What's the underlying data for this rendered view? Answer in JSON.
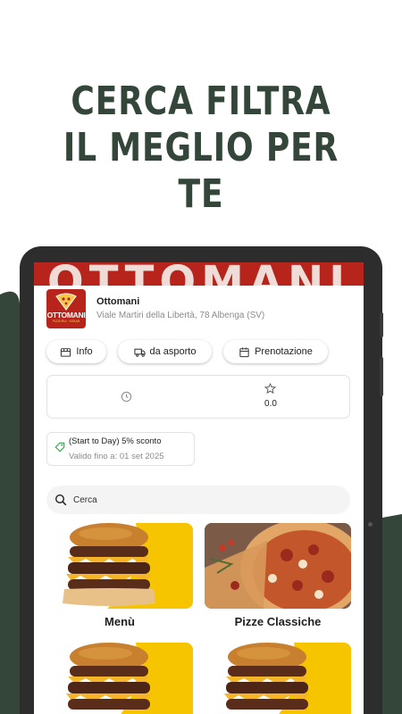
{
  "promo_headline": {
    "line1": "CERCA FILTRA",
    "line2": "IL MEGLIO PER TE"
  },
  "colors": {
    "brand_green": "#34463a",
    "brand_red": "#b6241c",
    "accent_yellow": "#f7c400"
  },
  "restaurant": {
    "banner_text": "OTTOMANI",
    "logo_text": "OTTOMANI",
    "logo_subtitle": "PIZZERIA · KEBAB",
    "name": "Ottomani",
    "address": "Viale Martiri della Libertà, 78 Albenga (SV)"
  },
  "tabs": [
    {
      "label": "Info",
      "icon": "storefront-icon"
    },
    {
      "label": "da asporto",
      "icon": "delivery-truck-icon"
    },
    {
      "label": "Prenotazione",
      "icon": "calendar-icon"
    }
  ],
  "info": {
    "rating": "0.0",
    "hours_icon": "clock-icon",
    "rating_icon": "star-icon"
  },
  "promo": {
    "title": "(Start to Day) 5% sconto",
    "valid": "Valido fino a: 01 set 2025",
    "icon": "tag-icon"
  },
  "search": {
    "placeholder": "Cerca"
  },
  "categories": [
    {
      "label": "Menù",
      "image": "burger-photo"
    },
    {
      "label": "Pizze Classiche",
      "image": "pizza-photo"
    },
    {
      "label": "",
      "image": "burger-photo"
    },
    {
      "label": "",
      "image": "burger-photo"
    }
  ]
}
